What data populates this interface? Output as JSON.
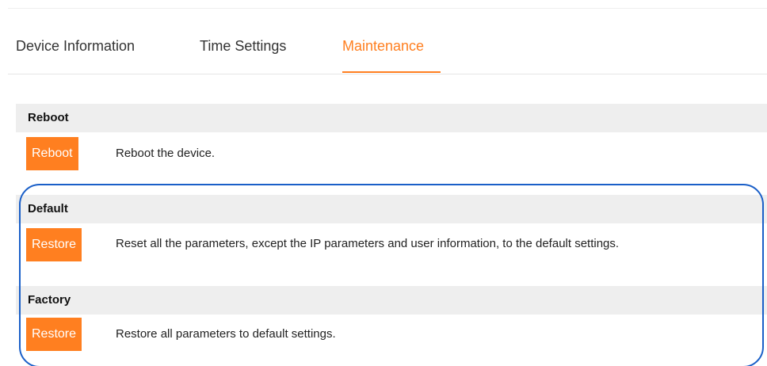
{
  "tabs": [
    {
      "label": "Device Information",
      "active": false
    },
    {
      "label": "Time Settings",
      "active": false
    },
    {
      "label": "Maintenance",
      "active": true
    }
  ],
  "sections": {
    "reboot": {
      "title": "Reboot",
      "button_label": "Reboot",
      "description": "Reboot the device."
    },
    "default": {
      "title": "Default",
      "button_label": "Restore",
      "description": "Reset all the parameters, except the IP parameters and user information, to the default settings."
    },
    "factory": {
      "title": "Factory",
      "button_label": "Restore",
      "description": "Restore all parameters to default settings."
    }
  },
  "colors": {
    "accent": "#ff7f20",
    "section_header_bg": "#eeeeee",
    "highlight_border": "#1a5fc8"
  }
}
